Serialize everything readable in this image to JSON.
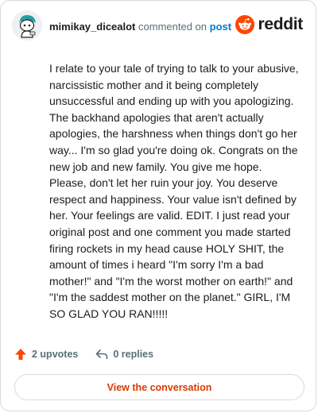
{
  "header": {
    "username": "mimikay_dicealot",
    "action_text": "commented on",
    "post_link": "post",
    "brand_name": "reddit"
  },
  "comment": {
    "body": "I relate to your tale of trying to talk to your abusive, narcissistic mother and it being completely unsuccessful and ending up with you apologizing. The backhand apologies that aren't actually apologies, the harshness when things don't go her way... I'm so glad you're doing ok. Congrats on the new job and new family. You give me hope. Please, don't let her ruin your joy. You deserve respect and happiness. Your value isn't defined by her. Your feelings are valid. EDIT. I just read your original post and one comment you made started firing rockets in my head cause HOLY SHIT, the amount of times i heard \"I'm sorry I'm a bad mother!\" and \"I'm the worst mother on earth!\" and \"I'm the saddest mother on the planet.\" GIRL, I'M SO GLAD YOU RAN!!!!!"
  },
  "actions": {
    "upvotes_label": "2 upvotes",
    "replies_label": "0 replies"
  },
  "footer": {
    "view_button_label": "View the conversation"
  },
  "icons": {
    "upvote": "upvote-arrow-icon",
    "reply": "reply-arrow-icon",
    "brand": "reddit-snoo-icon",
    "avatar": "user-avatar"
  },
  "colors": {
    "accent": "#ff4500",
    "link": "#0079d3",
    "button_text": "#d93a00",
    "muted": "#576f76"
  }
}
